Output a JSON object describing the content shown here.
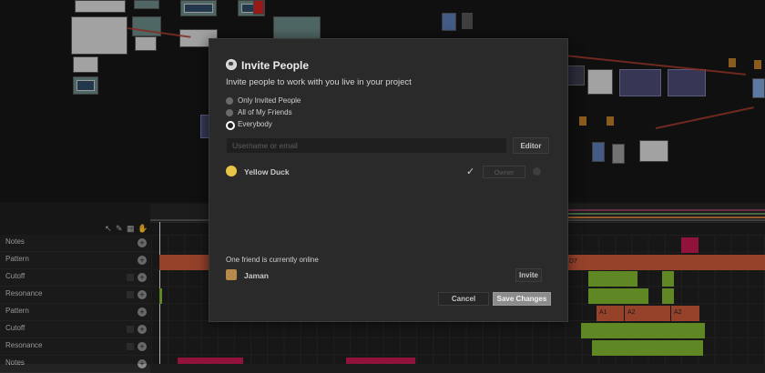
{
  "sequencer": {
    "lanes": [
      {
        "label": "Notes"
      },
      {
        "label": "Pattern"
      },
      {
        "label": "Cutoff"
      },
      {
        "label": "Resonance"
      },
      {
        "label": "Pattern"
      },
      {
        "label": "Cutoff"
      },
      {
        "label": "Resonance"
      },
      {
        "label": "Notes"
      }
    ],
    "clip_labels": [
      "D7",
      "A1",
      "A2",
      "A2"
    ]
  },
  "dialog": {
    "title": "Invite People",
    "subtitle": "Invite people to work with you live in your project",
    "options": [
      "Only Invited People",
      "All of My Friends",
      "Everybody"
    ],
    "selected_option": "Everybody",
    "search_placeholder": "Username or email",
    "editor_label": "Editor",
    "members": [
      {
        "name": "Yellow Duck",
        "role": "Owner"
      }
    ],
    "online_text": "One friend is currently online",
    "online_friends": [
      {
        "name": "Jaman",
        "action": "Invite"
      }
    ],
    "cancel_label": "Cancel",
    "save_label": "Save Changes"
  },
  "colors": {
    "accent_orange": "#c9583a",
    "accent_green": "#7fb431",
    "accent_pink": "#c2184e"
  }
}
